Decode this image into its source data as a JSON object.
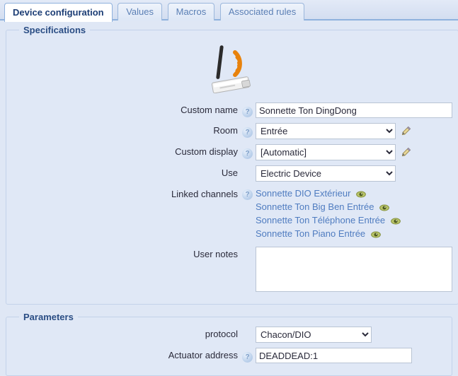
{
  "tabs": [
    {
      "label": "Device configuration",
      "active": true
    },
    {
      "label": "Values",
      "active": false
    },
    {
      "label": "Macros",
      "active": false
    },
    {
      "label": "Associated rules",
      "active": false
    }
  ],
  "specifications": {
    "legend": "Specifications",
    "device_icon": "wireless-usb-transmitter-icon",
    "custom_name": {
      "label": "Custom name",
      "help_icon": "question-mark-icon",
      "value": "Sonnette Ton DingDong",
      "placeholder": ""
    },
    "room": {
      "label": "Room",
      "help_icon": "question-mark-icon",
      "value": "Entrée",
      "edit_icon": "pencil-icon"
    },
    "custom_display": {
      "label": "Custom display",
      "help_icon": "question-mark-icon",
      "value": "[Automatic]",
      "edit_icon": "pencil-icon"
    },
    "use": {
      "label": "Use",
      "value": "Electric Device"
    },
    "linked_channels": {
      "label": "Linked channels",
      "help_icon": "question-mark-icon",
      "eye_icon": "eye-icon",
      "items": [
        "Sonnette DIO Extérieur",
        "Sonnette Ton Big Ben Entrée",
        "Sonnette Ton Téléphone Entrée",
        "Sonnette Ton Piano Entrée"
      ]
    },
    "user_notes": {
      "label": "User notes",
      "value": "",
      "placeholder": ""
    }
  },
  "parameters": {
    "legend": "Parameters",
    "protocol": {
      "label": "protocol",
      "value": "Chacon/DIO"
    },
    "actuator_address": {
      "label": "Actuator address",
      "help_icon": "question-mark-icon",
      "value": "DEADDEAD:1",
      "placeholder": ""
    }
  },
  "colors": {
    "page_background": "#dfe7f5",
    "legend_text": "#2a4d84",
    "link_text": "#4f7cc0",
    "active_tab_text": "#1c3d75",
    "inactive_tab_text": "#5a7fb5",
    "eye_icon": "#8a9c3e"
  }
}
